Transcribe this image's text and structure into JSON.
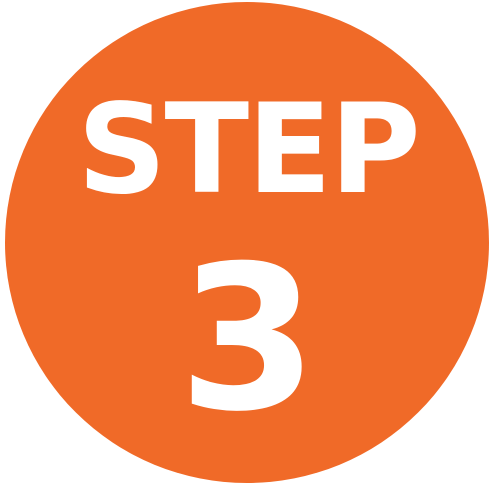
{
  "badge": {
    "label": "STEP",
    "number": "3",
    "background_color": "#f06a28",
    "text_color": "#ffffff"
  }
}
